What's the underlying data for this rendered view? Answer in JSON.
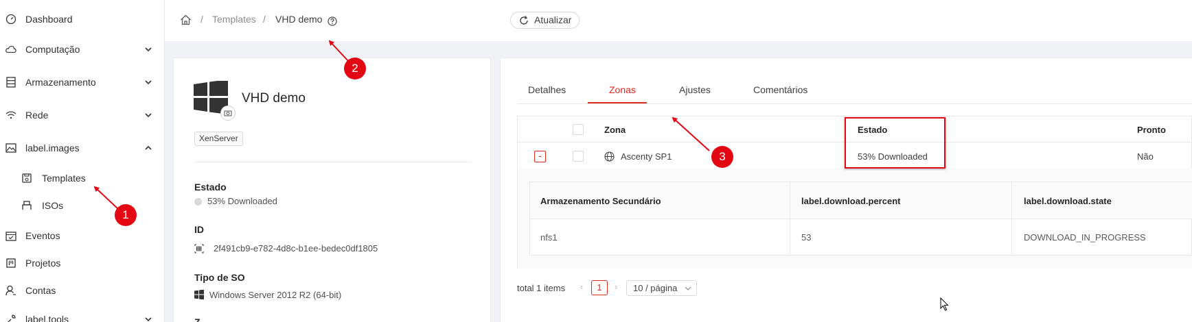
{
  "sidebar": {
    "items": [
      {
        "label": "Dashboard"
      },
      {
        "label": "Computação"
      },
      {
        "label": "Armazenamento"
      },
      {
        "label": "Rede"
      },
      {
        "label": "label.images"
      },
      {
        "label": "Templates"
      },
      {
        "label": "ISOs"
      },
      {
        "label": "Eventos"
      },
      {
        "label": "Projetos"
      },
      {
        "label": "Contas"
      },
      {
        "label": "label.tools"
      }
    ]
  },
  "breadcrumb": {
    "sep1": "/",
    "templates": "Templates",
    "sep2": "/",
    "current": "VHD demo"
  },
  "toolbar": {
    "refresh_label": "Atualizar"
  },
  "template": {
    "name": "VHD demo",
    "hypervisor": "XenServer",
    "state_label": "Estado",
    "state_value": "53% Downloaded",
    "id_label": "ID",
    "id_value": "2f491cb9-e782-4d8c-b1ee-bedec0df1805",
    "os_label": "Tipo de SO",
    "os_value": "Windows Server 2012 R2 (64-bit)",
    "next_label": "Z"
  },
  "tabs": {
    "details": "Detalhes",
    "zones": "Zonas",
    "settings": "Ajustes",
    "comments": "Comentários"
  },
  "zones_table": {
    "headers": {
      "zone": "Zona",
      "state": "Estado",
      "ready": "Pronto"
    },
    "rows": [
      {
        "expand": "-",
        "zone": "Ascenty SP1",
        "state": "53% Downloaded",
        "ready": "Não"
      }
    ]
  },
  "storage_table": {
    "headers": {
      "storage": "Armazenamento Secundário",
      "percent": "label.download.percent",
      "state": "label.download.state"
    },
    "rows": [
      {
        "storage": "nfs1",
        "percent": "53",
        "state": "DOWNLOAD_IN_PROGRESS"
      }
    ]
  },
  "pagination": {
    "total": "total 1 items",
    "current_page": "1",
    "page_size": "10 / página"
  },
  "annotations": {
    "m1": "1",
    "m2": "2",
    "m3": "3"
  },
  "colors": {
    "accent": "#e0281e",
    "marker": "#e30613"
  }
}
